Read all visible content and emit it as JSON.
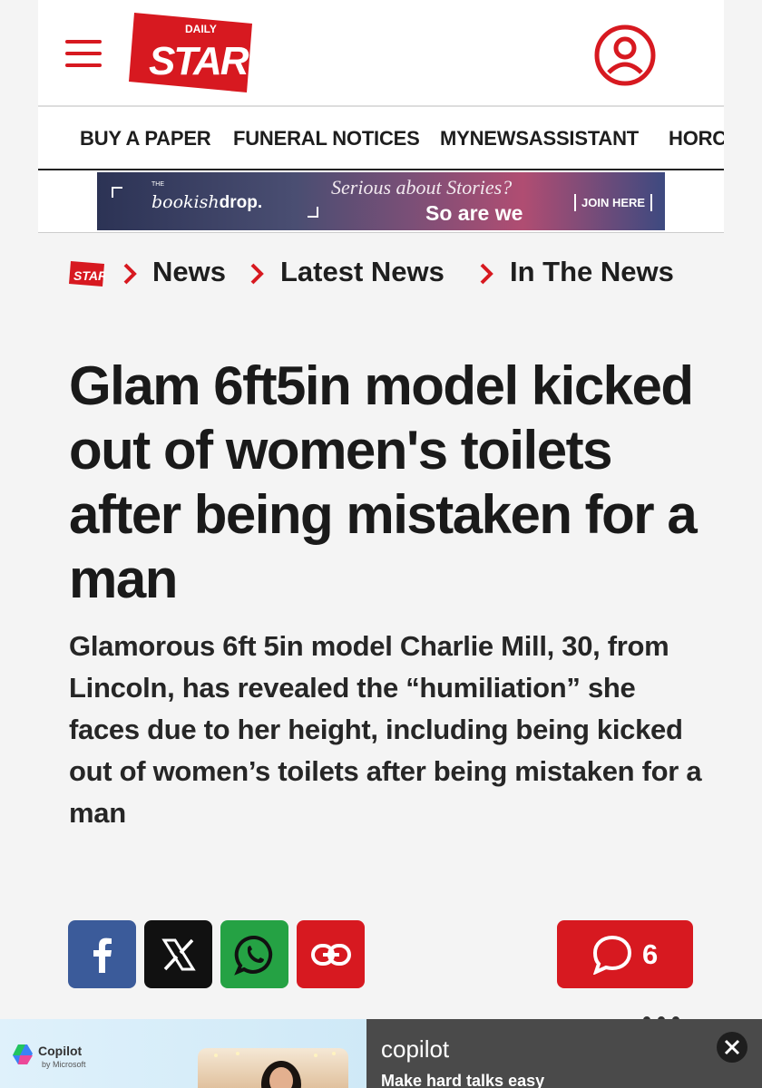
{
  "header": {
    "logo_top": "DAILY",
    "logo_main": "STAR"
  },
  "nav": {
    "items": [
      "BUY A PAPER",
      "FUNERAL NOTICES",
      "MYNEWSASSISTANT",
      "HORC"
    ]
  },
  "banner_ad": {
    "the": "THE",
    "brand_light": "bookish",
    "brand_bold": "drop.",
    "line1": "Serious about Stories?",
    "line2": "So are we",
    "cta": "JOIN HERE"
  },
  "breadcrumb": {
    "items": [
      "News",
      "Latest News",
      "In The News"
    ]
  },
  "article": {
    "headline": "Glam 6ft5in model kicked out of women's toilets after being mistaken for a man",
    "standfirst": "Glamorous 6ft 5in model Charlie Mill, 30, from Lincoln, has revealed the “humiliation” she faces due to her height, including being kicked out of women’s toilets after being mistaken for a man"
  },
  "share": {
    "comment_count": "6"
  },
  "bottom_ad": {
    "brand": "Copilot",
    "by": "by Microsoft",
    "title": "copilot",
    "subtitle": "Make hard talks easy"
  },
  "colors": {
    "brand_red": "#d71920",
    "facebook": "#3b5b9a",
    "whatsapp": "#25a244"
  }
}
